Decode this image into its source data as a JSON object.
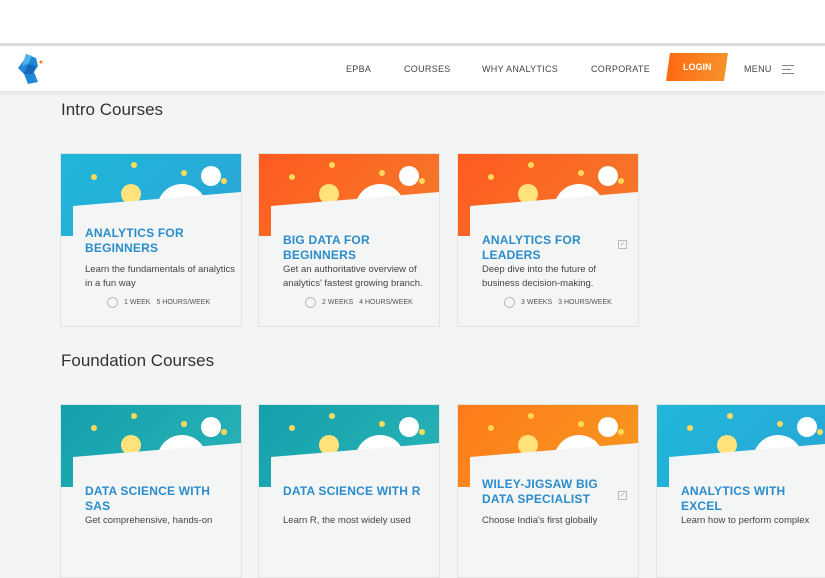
{
  "nav": {
    "items": [
      "EPBA",
      "COURSES",
      "WHY ANALYTICS",
      "CORPORATE"
    ],
    "login": "LOGIN",
    "menu": "MENU"
  },
  "sections": [
    {
      "title": "Intro Courses",
      "cards": [
        {
          "title": "ANALYTICS FOR BEGINNERS",
          "desc": "Learn the fundamentals of analytics in a fun way",
          "duration": "1 WEEK",
          "hours": "5 HOURS/WEEK",
          "theme": "blue"
        },
        {
          "title": "BIG DATA FOR BEGINNERS",
          "desc": "Get an authoritative overview of analytics' fastest growing branch.",
          "duration": "2 WEEKS",
          "hours": "4 HOURS/WEEK",
          "theme": "orange"
        },
        {
          "title": "ANALYTICS FOR LEADERS",
          "desc": "Deep dive into the future of business decision-making.",
          "duration": "3 WEEKS",
          "hours": "3 HOURS/WEEK",
          "theme": "orange"
        }
      ]
    },
    {
      "title": "Foundation Courses",
      "cards": [
        {
          "title": "DATA SCIENCE WITH SAS",
          "desc": "Get comprehensive, hands-on",
          "theme": "teal"
        },
        {
          "title": "DATA SCIENCE WITH R",
          "desc": "Learn R, the most widely used",
          "theme": "teal"
        },
        {
          "title": "WILEY-JIGSAW BIG DATA SPECIALIST",
          "desc": "Choose India's first globally",
          "theme": "orange2"
        },
        {
          "title": "ANALYTICS WITH EXCEL",
          "desc": "Learn how to perform complex",
          "theme": "blue"
        }
      ]
    }
  ]
}
